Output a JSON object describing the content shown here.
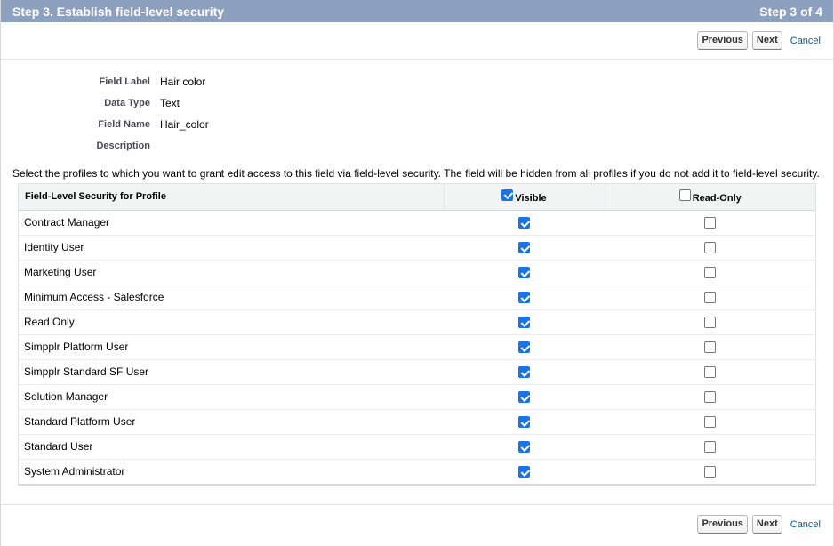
{
  "header": {
    "title": "Step 3. Establish field-level security",
    "step": "Step 3 of 4"
  },
  "buttons": {
    "previous": "Previous",
    "next": "Next",
    "cancel": "Cancel"
  },
  "field_info": [
    {
      "label": "Field Label",
      "value": "Hair color"
    },
    {
      "label": "Data Type",
      "value": "Text"
    },
    {
      "label": "Field Name",
      "value": "Hair_color"
    },
    {
      "label": "Description",
      "value": ""
    }
  ],
  "instructions": "Select the profiles to which you want to grant edit access to this field via field-level security. The field will be hidden from all profiles if you do not add it to field-level security.",
  "table": {
    "headers": {
      "profile": "Field-Level Security for Profile",
      "visible": "Visible",
      "read_only": "Read-Only"
    },
    "header_visible_checked": true,
    "header_read_only_checked": false,
    "rows": [
      {
        "profile": "Contract Manager",
        "visible": true,
        "read_only": false
      },
      {
        "profile": "Identity User",
        "visible": true,
        "read_only": false
      },
      {
        "profile": "Marketing User",
        "visible": true,
        "read_only": false
      },
      {
        "profile": "Minimum Access - Salesforce",
        "visible": true,
        "read_only": false
      },
      {
        "profile": "Read Only",
        "visible": true,
        "read_only": false
      },
      {
        "profile": "Simpplr Platform User",
        "visible": true,
        "read_only": false
      },
      {
        "profile": "Simpplr Standard SF User",
        "visible": true,
        "read_only": false
      },
      {
        "profile": "Solution Manager",
        "visible": true,
        "read_only": false
      },
      {
        "profile": "Standard Platform User",
        "visible": true,
        "read_only": false
      },
      {
        "profile": "Standard User",
        "visible": true,
        "read_only": false
      },
      {
        "profile": "System Administrator",
        "visible": true,
        "read_only": false
      }
    ]
  },
  "colors": {
    "header_bg": "#8ea0bf",
    "link": "#015ba7",
    "checkbox_accent": "#1a73e8"
  }
}
